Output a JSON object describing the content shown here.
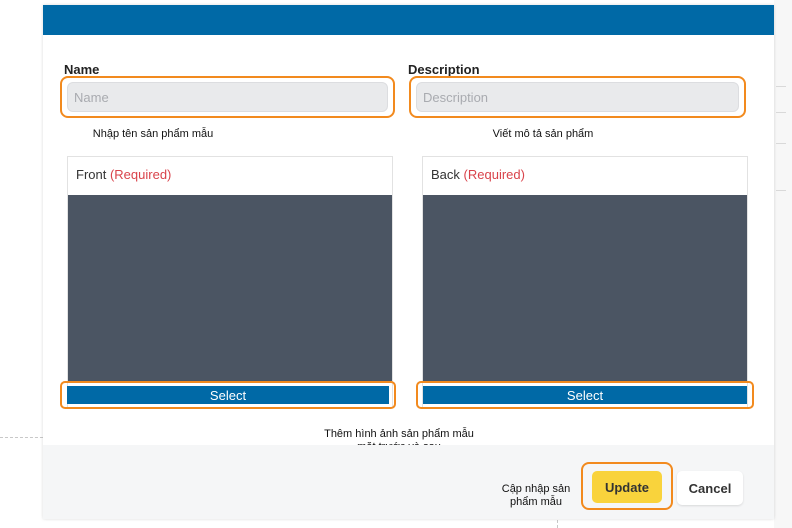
{
  "form": {
    "name_label": "Name",
    "name_placeholder": "Name",
    "name_value": "",
    "name_note": "Nhập tên sản phẩm mẫu",
    "description_label": "Description",
    "description_placeholder": "Description",
    "description_value": "",
    "description_note": "Viết mô tả sản phẩm"
  },
  "images": {
    "front_label": "Front",
    "back_label": "Back",
    "required_text": "(Required)",
    "select_label": "Select",
    "note_line1": "Thêm hình ảnh sản phẩm mẫu",
    "note_line2": "mặt trước và sau"
  },
  "footer": {
    "update_note_line1": "Cập nhập sản",
    "update_note_line2": "phẩm mẫu",
    "update_label": "Update",
    "cancel_label": "Cancel"
  },
  "colors": {
    "header": "#0069a6",
    "highlight": "#f28a1e",
    "update_button": "#f9d33c",
    "required": "#d9434b",
    "image_placeholder": "#4b5563"
  }
}
